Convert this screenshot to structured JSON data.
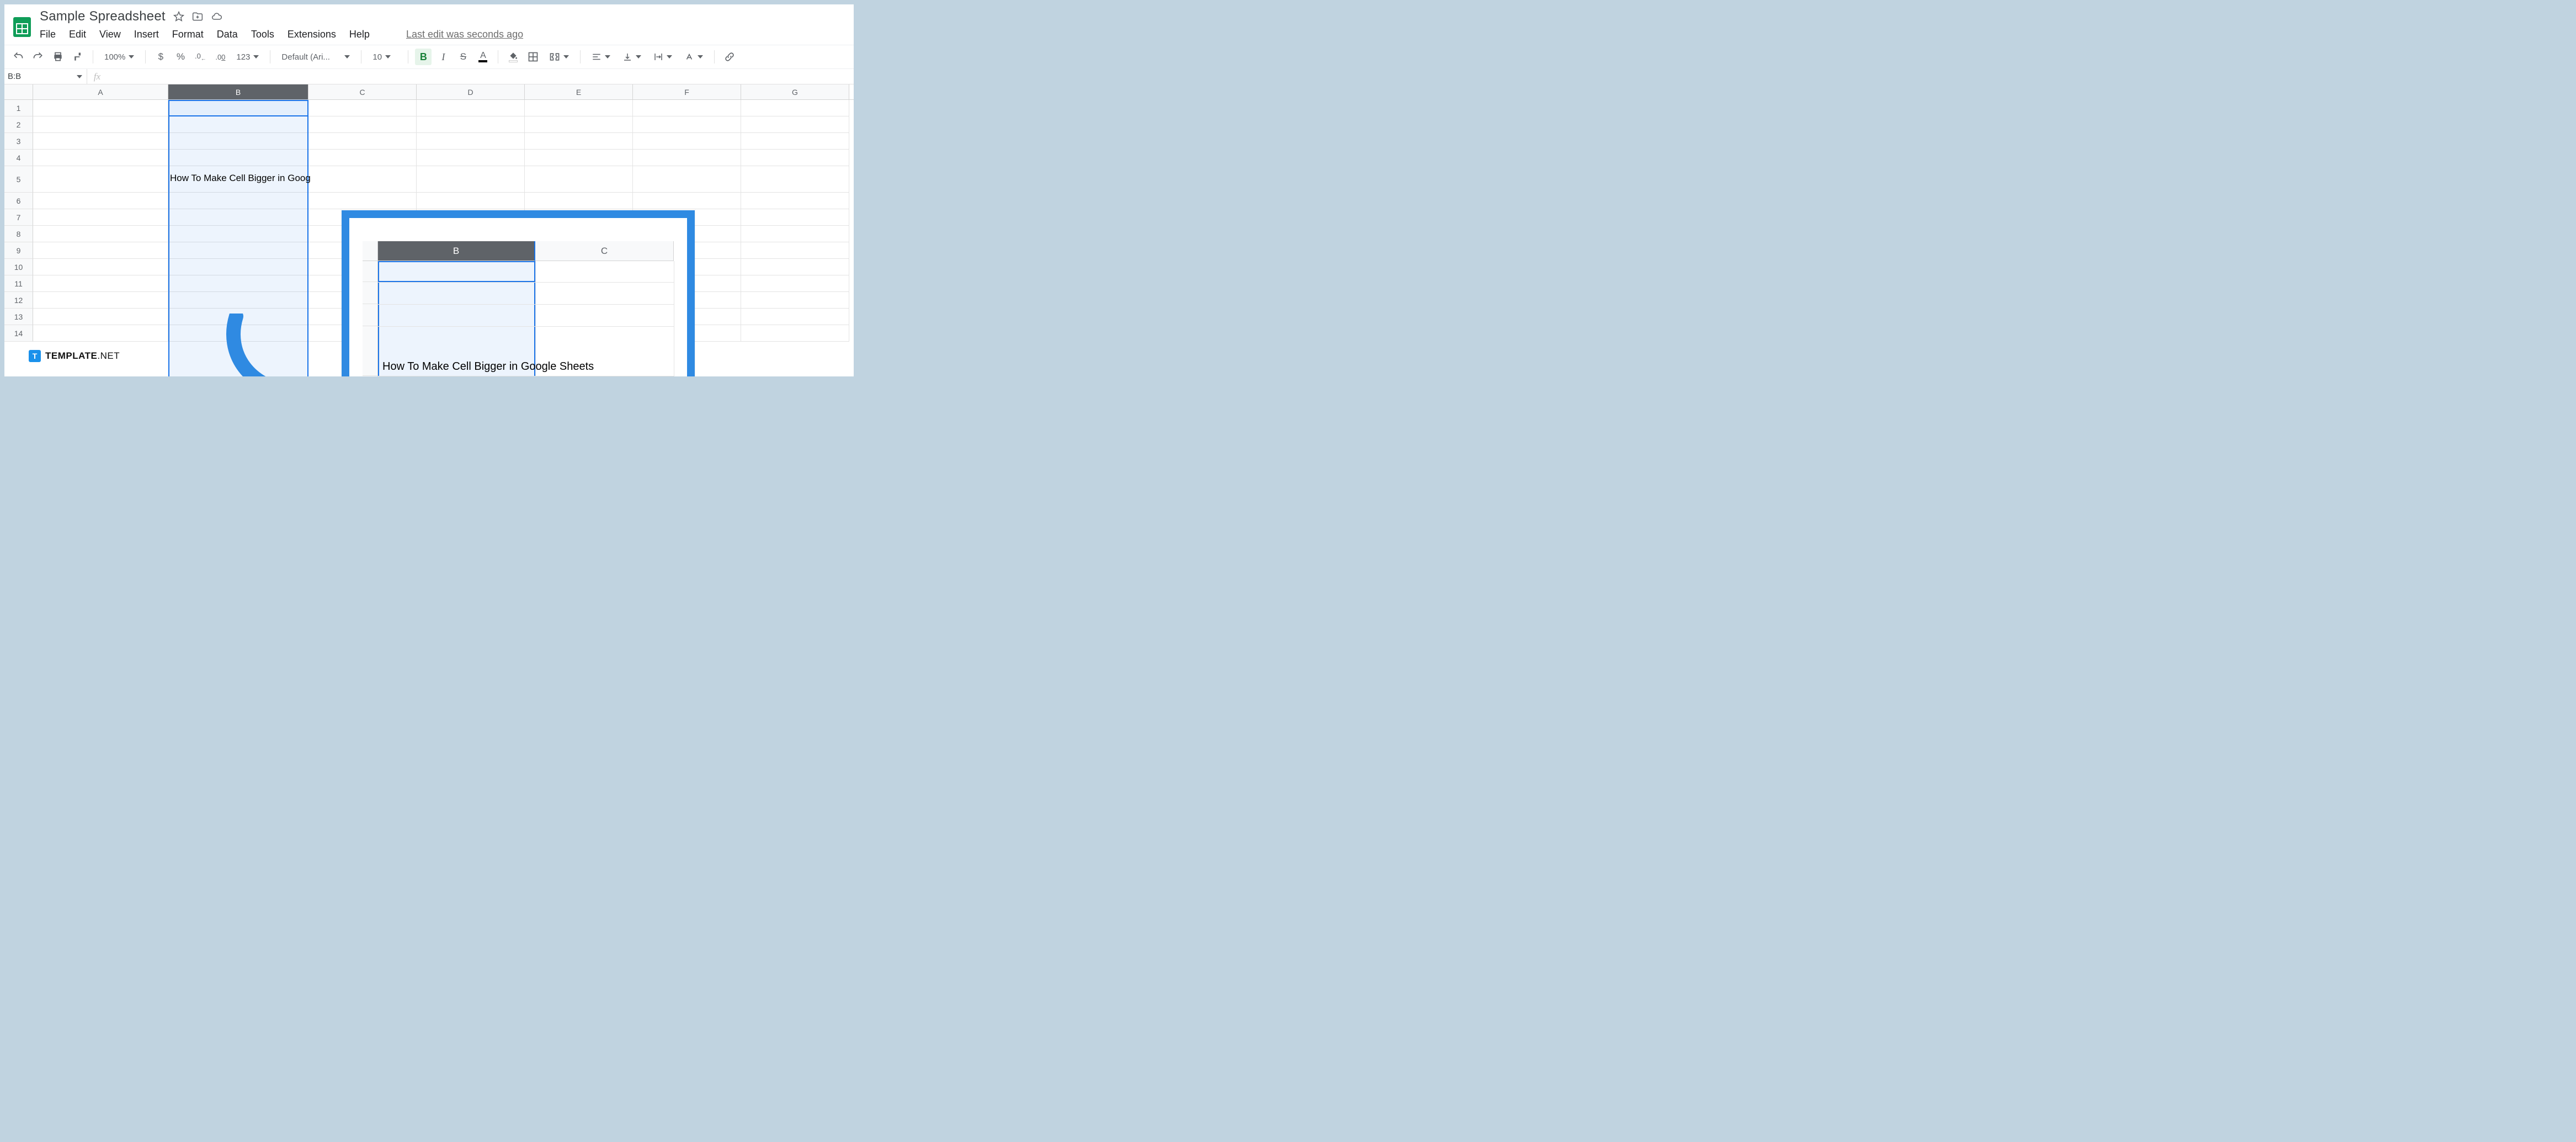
{
  "header": {
    "doc_title": "Sample Spreadsheet",
    "menu": {
      "file": "File",
      "edit": "Edit",
      "view": "View",
      "insert": "Insert",
      "format": "Format",
      "data": "Data",
      "tools": "Tools",
      "extensions": "Extensions",
      "help": "Help"
    },
    "last_edit": "Last edit was seconds ago"
  },
  "toolbar": {
    "zoom": "100%",
    "currency": "$",
    "percent": "%",
    "dec_decrease": ".0",
    "dec_increase": ".00",
    "more_formats": "123",
    "font": "Default (Ari...",
    "font_size": "10",
    "bold": "B",
    "italic": "I",
    "strike": "S",
    "text_color": "A"
  },
  "namebox": {
    "ref": "B:B",
    "fx": "fx"
  },
  "columns": [
    "A",
    "B",
    "C",
    "D",
    "E",
    "F",
    "G"
  ],
  "rows": [
    "1",
    "2",
    "3",
    "4",
    "5",
    "6",
    "7",
    "8",
    "9",
    "10",
    "11",
    "12",
    "13",
    "14"
  ],
  "cellB5": "How To Make Cell Bigger in Goog",
  "callout": {
    "colB": "B",
    "colC": "C",
    "text": "How To Make Cell Bigger in Google Sheets"
  },
  "watermark": {
    "logo_letter": "T",
    "brand": "TEMPLATE",
    "suffix": ".NET"
  }
}
